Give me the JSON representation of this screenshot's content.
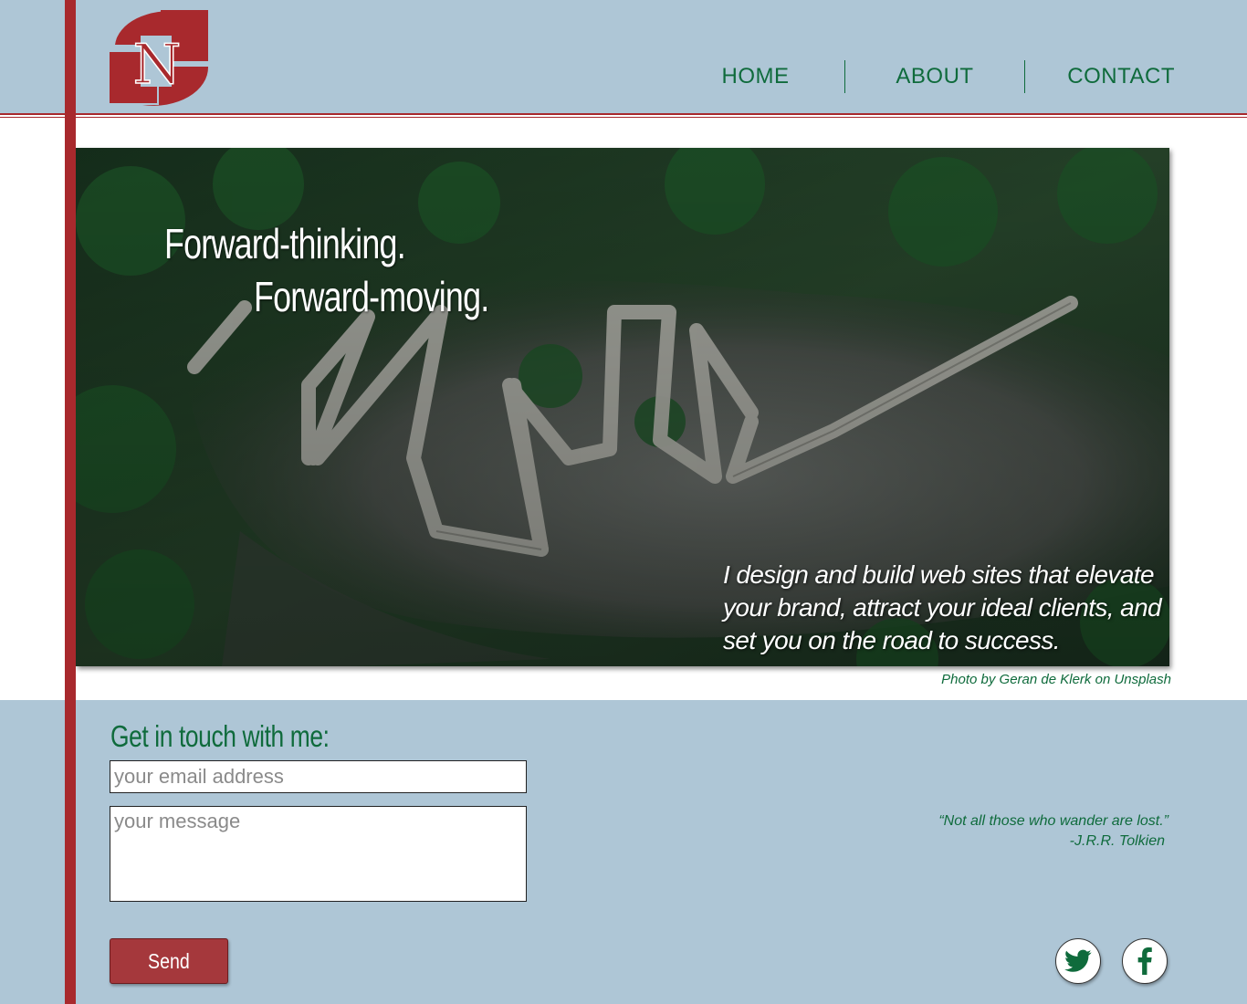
{
  "brand": {
    "logo_letter": "N",
    "colors": {
      "accent": "#a8292d",
      "green": "#0f6b3c",
      "header_bg": "#aec6d6"
    }
  },
  "nav": {
    "items": [
      {
        "label": "HOME"
      },
      {
        "label": "ABOUT"
      },
      {
        "label": "CONTACT"
      }
    ]
  },
  "hero": {
    "line1": "Forward-thinking.",
    "line2": "Forward-moving.",
    "tagline": "I design and build web sites that elevate your brand, attract your ideal clients, and set you on the road to success.",
    "photo_credit": "Photo by Geran de Klerk on Unsplash"
  },
  "contact": {
    "heading": "Get in touch with me:",
    "email_placeholder": "your email address",
    "message_placeholder": "your message",
    "send_label": "Send"
  },
  "quote": {
    "text": "“Not all those who wander are lost.”",
    "author": "-J.R.R. Tolkien"
  },
  "social": [
    {
      "icon": "twitter-icon"
    },
    {
      "icon": "facebook-icon"
    }
  ]
}
